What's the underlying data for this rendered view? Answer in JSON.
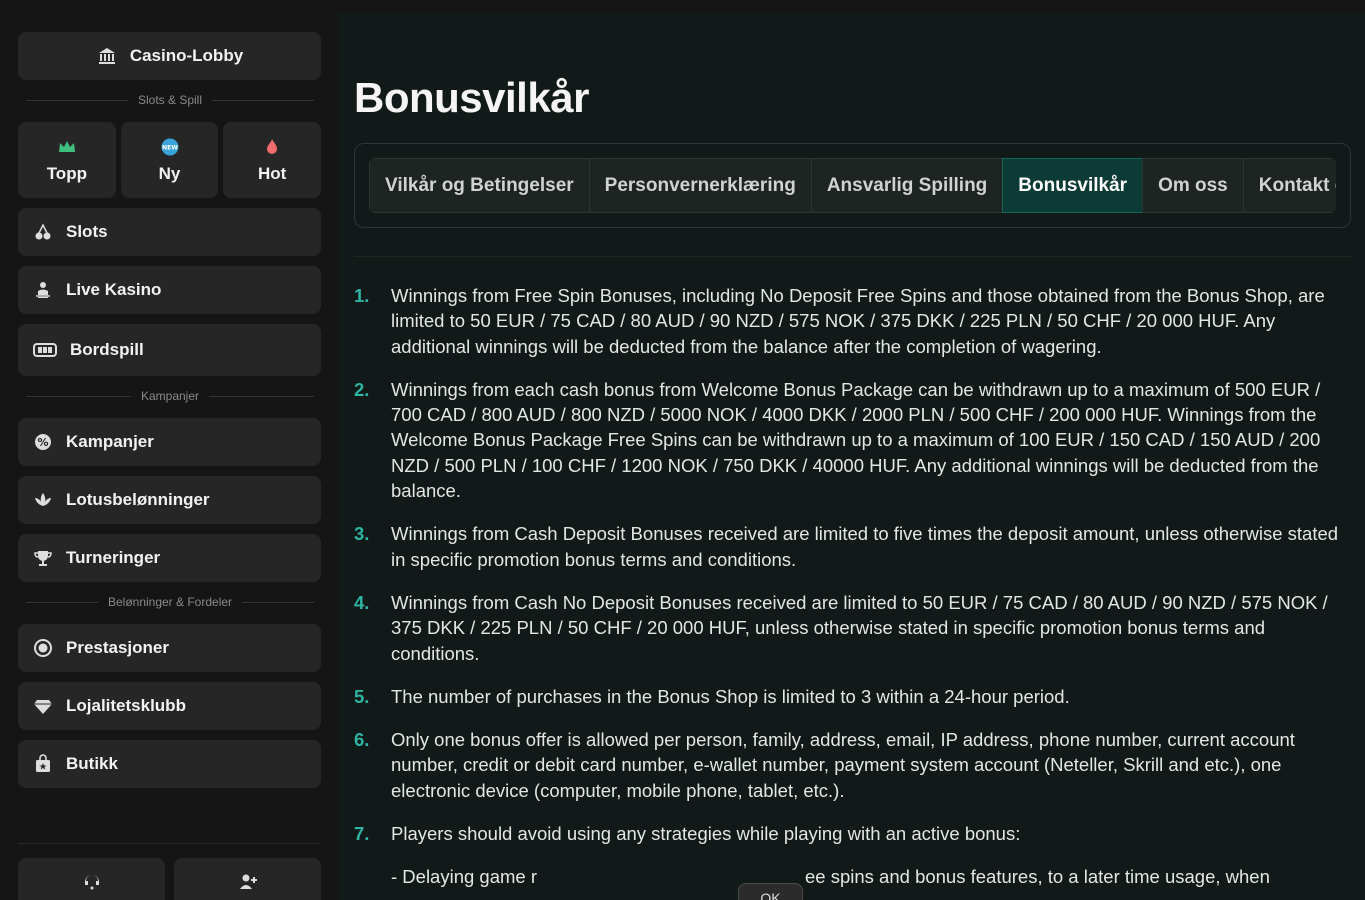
{
  "sidebar": {
    "lobby_label": "Casino-Lobby",
    "sections": {
      "slots": "Slots & Spill",
      "campaigns": "Kampanjer",
      "rewards": "Belønninger & Fordeler"
    },
    "quick": [
      {
        "label": "Topp",
        "icon": "crown-icon",
        "color": "#3fbf7f"
      },
      {
        "label": "Ny",
        "icon": "new-badge-icon",
        "color": "#3aa3d9"
      },
      {
        "label": "Hot",
        "icon": "flame-icon",
        "color": "#f06b6b"
      }
    ],
    "items": [
      {
        "label": "Slots",
        "icon": "cherries-icon"
      },
      {
        "label": "Live Kasino",
        "icon": "dealer-icon"
      },
      {
        "label": "Bordspill",
        "icon": "table-game-icon"
      },
      {
        "label": "Kampanjer",
        "icon": "promo-icon"
      },
      {
        "label": "Lotusbelønninger",
        "icon": "lotus-icon"
      },
      {
        "label": "Turneringer",
        "icon": "trophy-icon"
      },
      {
        "label": "Prestasjoner",
        "icon": "achievement-icon"
      },
      {
        "label": "Lojalitetsklubb",
        "icon": "diamond-icon"
      },
      {
        "label": "Butikk",
        "icon": "shop-bag-icon"
      }
    ],
    "bottom": [
      {
        "icon": "support-chat-icon"
      },
      {
        "icon": "add-user-icon"
      }
    ]
  },
  "main": {
    "title": "Bonusvilkår",
    "tabs": [
      {
        "label": "Vilkår og Betingelser",
        "active": false
      },
      {
        "label": "Personvernerklæring",
        "active": false
      },
      {
        "label": "Ansvarlig Spilling",
        "active": false
      },
      {
        "label": "Bonusvilkår",
        "active": true
      },
      {
        "label": "Om oss",
        "active": false
      },
      {
        "label": "Kontakt oss",
        "active": false
      }
    ],
    "terms": [
      {
        "num": "1.",
        "text": "Winnings from Free Spin Bonuses, including No Deposit Free Spins and those obtained from the Bonus Shop, are limited to 50 EUR / 75 CAD / 80 AUD / 90 NZD / 575 NOK / 375 DKK / 225 PLN / 50 CHF / 20 000 HUF. Any additional winnings will be deducted from the balance after the completion of wagering."
      },
      {
        "num": "2.",
        "text": "Winnings from each cash bonus from Welcome Bonus Package can be withdrawn up to a maximum of 500 EUR / 700 CAD / 800 AUD / 800 NZD / 5000 NOK / 4000 DKK / 2000 PLN / 500 CHF / 200 000 HUF. Winnings from the Welcome Bonus Package Free Spins can be withdrawn up to a maximum of 100 EUR / 150 CAD / 150 AUD / 200 NZD / 500 PLN / 100 CHF / 1200 NOK / 750 DKK / 40000 HUF. Any additional winnings will be deducted from the balance."
      },
      {
        "num": "3.",
        "text": "Winnings from Cash Deposit Bonuses received are limited to five times the deposit amount, unless otherwise stated in specific promotion bonus terms and conditions."
      },
      {
        "num": "4.",
        "text": "Winnings from Cash No Deposit Bonuses received are limited to 50 EUR / 75 CAD / 80 AUD / 90 NZD / 575 NOK / 375 DKK / 225 PLN / 50 CHF / 20 000 HUF, unless otherwise stated in specific promotion bonus terms and conditions."
      },
      {
        "num": "5.",
        "text": "The number of purchases in the Bonus Shop is limited to 3 within a 24-hour period."
      },
      {
        "num": "6.",
        "text": "Only one bonus offer is allowed per person, family, address, email, IP address, phone number, current account number, credit or debit card number, e-wallet number, payment system account (Neteller, Skrill and etc.), one electronic device (computer, mobile phone, tablet, etc.)."
      },
      {
        "num": "7.",
        "text": "Players should avoid using any strategies while playing with an active bonus:"
      }
    ],
    "subitem_left": "- Delaying game r",
    "subitem_right": "ee spins and bonus features, to a later time usage, when",
    "ok_label": "OK"
  }
}
